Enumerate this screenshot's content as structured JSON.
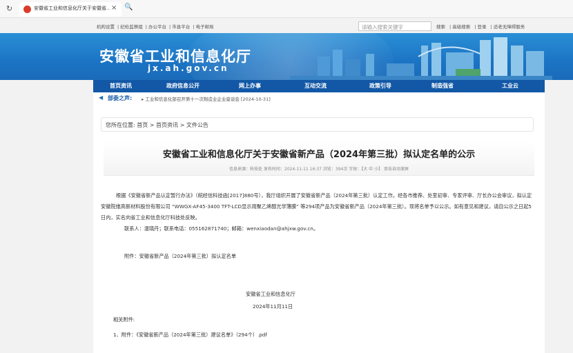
{
  "browser": {
    "tab_title": "安徽省工业和信息化厅关于安徽省...",
    "close": "×",
    "refresh": "↻",
    "search": "🔍"
  },
  "topnav": {
    "links": [
      "机构设置",
      "纪检监察组",
      "办公平台",
      "市县平台",
      "电子邮局"
    ],
    "search_placeholder": "请输入搜索关键字",
    "right_links": [
      "搜索",
      "高级搜索",
      "登录",
      "适老无障碍服务"
    ]
  },
  "banner": {
    "site_title": "安徽省工业和信息化厅",
    "domain": "jx.ah.gov.cn"
  },
  "mainnav": {
    "items": [
      "首页资讯",
      "政府信息公开",
      "网上办事",
      "互动交流",
      "政策引导",
      "制造强省",
      "工业云"
    ]
  },
  "ticker": {
    "label": "部委之声:",
    "news": "▸ 工业和信息化部召开第十一次制造业企业座谈会 [2024-10-31]"
  },
  "article": {
    "breadcrumb": "您所在位置: 首页 > 首页资讯 > 文件公告",
    "title": "安徽省工业和信息化厅关于安徽省新产品（2024年第三批）拟认定名单的公示",
    "meta": "信息来源：科技处  发布时间：2024-11-11 16:37  浏览：394次  字体：【大 中 小】  双击自动滚屏",
    "paragraph": "根据《安徽省新产品认定暂行办法》（皖经信科技函[2017]880号），我厅组织开展了安徽省新产品（2024年第三批）认定工作。经各市推荐、处室初审、专家评审、厅长办公会审议，拟认定安徽院维高新材料股份有限公司 “WWGX-AF45-3400 TFT-LCD显示用聚乙烯醇光学薄膜” 等294项产品为安徽省新产品（2024年第三批）。现将名单予以公示。如有意见和建议，请自公示之日起5日内，实名向省工业和信息化厅科技处反映。",
    "contact": "联系人：温晓丹；联系电话：055162871740；邮箱：wenxiaodan@ahjxw.gov.cn。",
    "attachment_note": "附件：安徽省新产品（2024年第三批）拟认定名单",
    "signature_org": "安徽省工业和信息化厅",
    "signature_date": "2024年11月11日",
    "related_label": "相关附件:",
    "related_file": "1、附件：《安徽省新产品（2024年第三批）建议名单》（294个）.pdf"
  }
}
